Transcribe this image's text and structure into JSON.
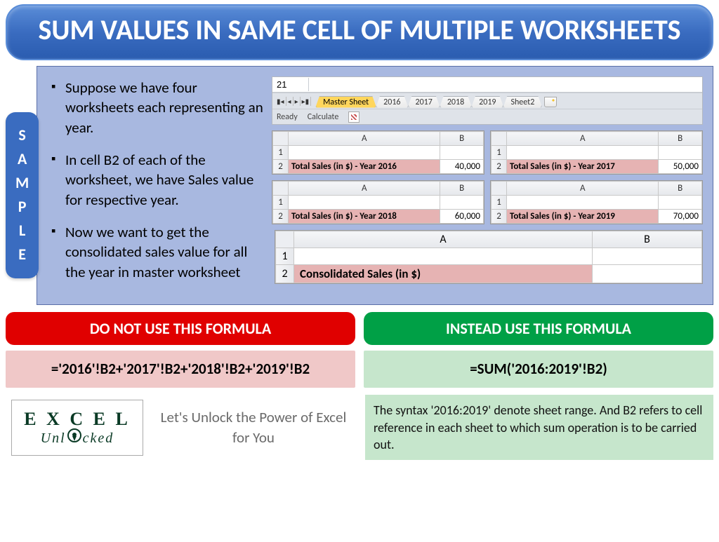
{
  "title": "SUM VALUES IN SAME CELL OF MULTIPLE WORKSHEETS",
  "sample_label": "SAMPLE",
  "bullets": [
    "Suppose we have four worksheets each representing an year.",
    "In cell B2 of each of the worksheet, we have Sales value for respective year.",
    "Now we want to get the consolidated sales value for all the year in master worksheet"
  ],
  "tabbar": {
    "cellref": "21",
    "status_ready": "Ready",
    "status_calc": "Calculate",
    "tabs": [
      "Master Sheet",
      "2016",
      "2017",
      "2018",
      "2019",
      "Sheet2"
    ]
  },
  "year_sheets": [
    {
      "label": "Total Sales (in $) - Year 2016",
      "value": "40,000"
    },
    {
      "label": "Total Sales (in $) - Year 2017",
      "value": "50,000"
    },
    {
      "label": "Total Sales (in $) - Year 2018",
      "value": "60,000"
    },
    {
      "label": "Total Sales (in $) - Year 2019",
      "value": "70,000"
    }
  ],
  "columns": {
    "A": "A",
    "B": "B",
    "r1": "1",
    "r2": "2"
  },
  "consolidated": {
    "label": "Consolidated Sales (in $)",
    "value": ""
  },
  "dont": {
    "header": "DO NOT USE THIS FORMULA",
    "formula": "='2016'!B2+'2017'!B2+'2018'!B2+'2019'!B2"
  },
  "do": {
    "header": "INSTEAD USE THIS FORMULA",
    "formula": "=SUM('2016:2019'!B2)",
    "desc": "The syntax '2016:2019' denote sheet range. And B2 refers to cell reference in each sheet to which sum operation is to be carried out."
  },
  "logo": {
    "word": "EXCEL",
    "sub": "Unlocked"
  },
  "tagline": "Let's Unlock the Power of Excel for You"
}
